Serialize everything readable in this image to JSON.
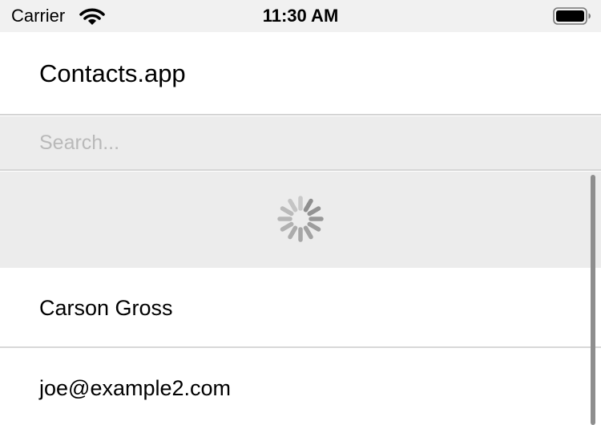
{
  "status_bar": {
    "carrier": "Carrier",
    "time": "11:30 AM",
    "icons": [
      "wifi-icon",
      "battery-icon"
    ]
  },
  "header": {
    "title": "Contacts.app"
  },
  "search": {
    "placeholder": "Search...",
    "value": ""
  },
  "loading": {
    "icon": "spinner-icon"
  },
  "contacts": [
    {
      "label": "Carson Gross"
    },
    {
      "label": "joe@example2.com"
    }
  ],
  "colors": {
    "status_bar_bg": "#f1f1f1",
    "search_bg": "#ececec",
    "divider": "#d6d6d6",
    "spinner": "#8a8a8a",
    "scrollbar": "#8e8e8e"
  }
}
